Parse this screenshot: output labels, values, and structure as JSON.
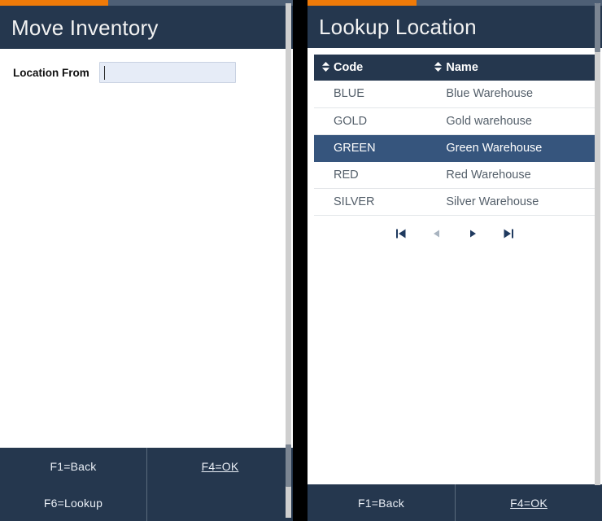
{
  "theme": {
    "navy": "#25374e",
    "orange": "#ef7a08",
    "progress_track": "#4e5f75",
    "selected_row": "#36557d",
    "input_bg": "#e6ecf7",
    "row_text": "#55606b"
  },
  "left_panel": {
    "progress": {
      "percent": 37,
      "fill_color": "#ef7a08",
      "track_color": "#4e5f75"
    },
    "title": "Move Inventory",
    "form": {
      "fields": [
        {
          "label": "Location From",
          "value": "",
          "placeholder": ""
        }
      ]
    },
    "footer": {
      "keys": [
        {
          "label": "F1=Back",
          "underline": false
        },
        {
          "label": "F4=OK",
          "underline": true
        },
        {
          "label": "F6=Lookup",
          "underline": false
        },
        {
          "label": "",
          "underline": false
        }
      ]
    }
  },
  "right_panel": {
    "progress": {
      "percent": 37,
      "fill_color": "#ef7a08",
      "track_color": "#4e5f75"
    },
    "title": "Lookup Location",
    "table": {
      "columns": [
        {
          "label": "Code",
          "sort_icon": "sort-updown-icon"
        },
        {
          "label": "Name",
          "sort_icon": "sort-updown-icon"
        }
      ],
      "rows": [
        {
          "code": "BLUE",
          "name": "Blue Warehouse",
          "selected": false
        },
        {
          "code": "GOLD",
          "name": "Gold warehouse",
          "selected": false
        },
        {
          "code": "GREEN",
          "name": "Green Warehouse",
          "selected": true
        },
        {
          "code": "RED",
          "name": "Red Warehouse",
          "selected": false
        },
        {
          "code": "SILVER",
          "name": "Silver Warehouse",
          "selected": false
        }
      ]
    },
    "pager": {
      "buttons": [
        {
          "name": "first-page-icon",
          "glyph": "first",
          "disabled": false
        },
        {
          "name": "previous-page-icon",
          "glyph": "previous",
          "disabled": true
        },
        {
          "name": "next-page-icon",
          "glyph": "next",
          "disabled": false
        },
        {
          "name": "last-page-icon",
          "glyph": "last",
          "disabled": false
        }
      ]
    },
    "footer": {
      "keys": [
        {
          "label": "F1=Back",
          "underline": false
        },
        {
          "label": "F4=OK",
          "underline": true
        }
      ]
    }
  }
}
